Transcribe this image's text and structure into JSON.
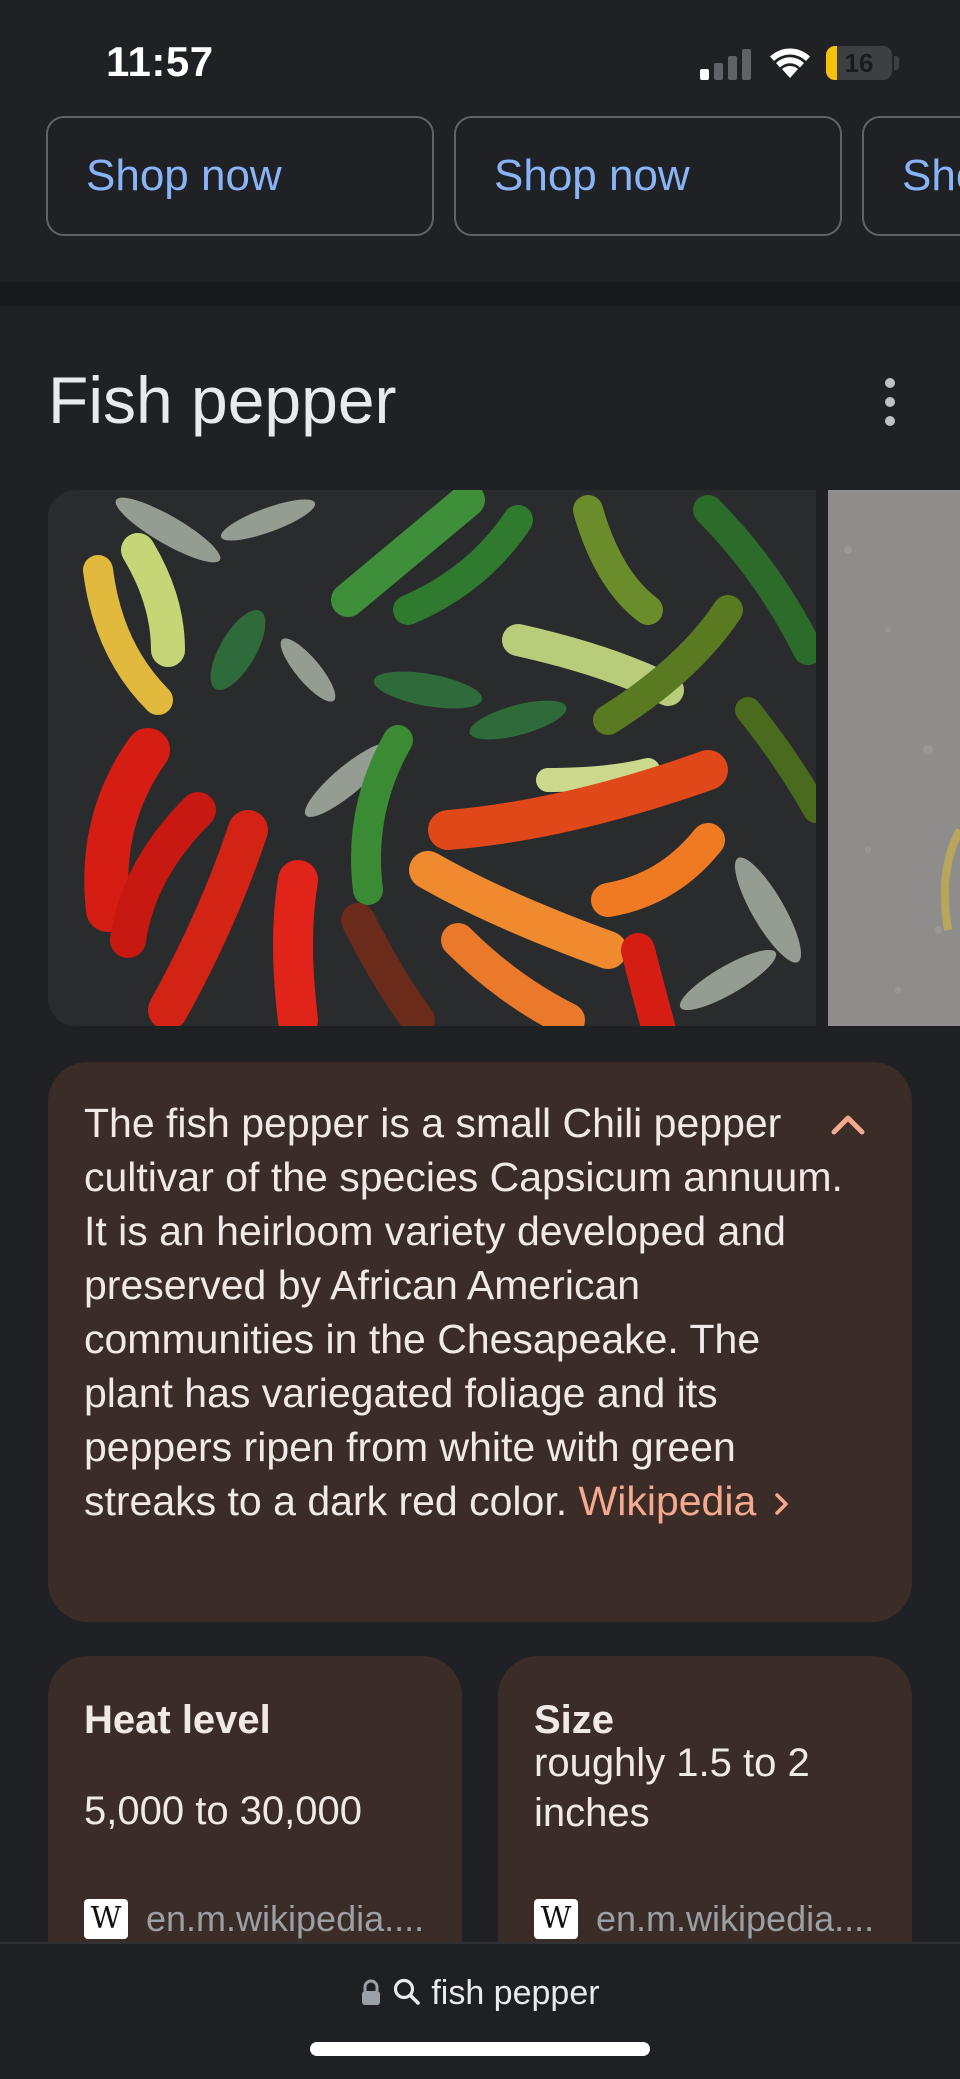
{
  "status_bar": {
    "time": "11:57",
    "battery_percent": "16",
    "battery_level": 0.16,
    "battery_color": "#f4c20d",
    "signal_icon": "cellular-signal-icon",
    "wifi_icon": "wifi-icon"
  },
  "shop_buttons": [
    {
      "label": "Shop now"
    },
    {
      "label": "Shop now"
    },
    {
      "label": "Shop now"
    }
  ],
  "panel": {
    "title": "Fish pepper",
    "more_icon": "more-vert-icon",
    "images": [
      {
        "subject": "assorted fish peppers in red, orange, yellow and green with leaves"
      },
      {
        "subject": "pepper on grey stone surface"
      }
    ],
    "description": {
      "text": "The fish pepper is a small Chili pepper cultivar of the species Capsicum annuum. It is an heirloom variety developed and preserved by African American communities in the Chesapeake. The plant has variegated foliage and its peppers ripen from white with green streaks to a dark red color.",
      "source_link": "Wikipedia",
      "collapse_icon": "chevron-up-icon"
    },
    "facts": [
      {
        "label": "Heat level",
        "value": "5,000 to 30,000",
        "source": "en.m.wikipedia...."
      },
      {
        "label": "Size",
        "value": "roughly 1.5 to 2 inches",
        "source": "en.m.wikipedia...."
      }
    ]
  },
  "bottom_bar": {
    "query": "fish pepper",
    "lock_icon": "lock-icon",
    "search_icon": "search-icon"
  },
  "colors": {
    "background": "#202124",
    "card": "#3b2c27",
    "link": "#8ab4f8",
    "accent": "#f5a98f"
  }
}
